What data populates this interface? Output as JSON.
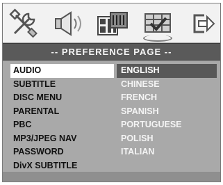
{
  "osd": {
    "icons": [
      "tools-icon",
      "speaker-icon",
      "film-icon",
      "preference-icon",
      "exit-icon"
    ],
    "active_icon": "preference-icon",
    "title": "-- PREFERENCE PAGE --",
    "menu_items": [
      "AUDIO",
      "SUBTITLE",
      "DISC MENU",
      "PARENTAL",
      "PBC",
      "MP3/JPEG NAV",
      "PASSWORD",
      "DivX SUBTITLE"
    ],
    "selected_menu": "AUDIO",
    "options": [
      "ENGLISH",
      "CHINESE",
      "FRENCH",
      "SPANISH",
      "PORTUGUESE",
      "POLISH",
      "ITALIAN"
    ],
    "selected_option": "ENGLISH"
  },
  "colors": {
    "panel": "#a9a9a9",
    "title_bar": "#5a5a5a",
    "selected_option_bg": "#585858",
    "selected_menu_bg": "#ffffff"
  }
}
